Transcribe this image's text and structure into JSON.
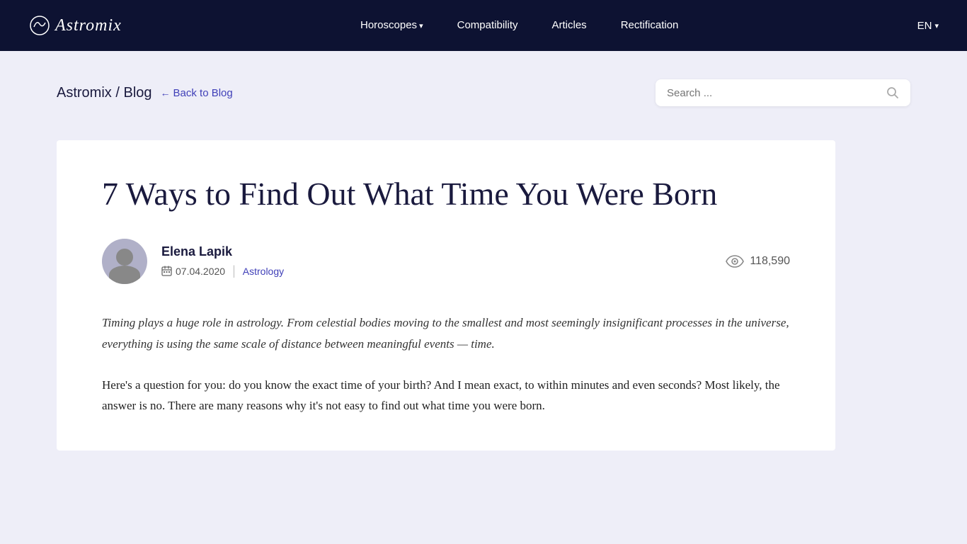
{
  "nav": {
    "logo_text": "Astromix",
    "links": [
      {
        "label": "Horoscopes",
        "has_arrow": true
      },
      {
        "label": "Compatibility",
        "has_arrow": false
      },
      {
        "label": "Articles",
        "has_arrow": false
      },
      {
        "label": "Rectification",
        "has_arrow": false
      }
    ],
    "lang": "EN"
  },
  "breadcrumb": {
    "site": "Astromix",
    "separator": "/",
    "section": "Blog",
    "back_label": "Back to Blog"
  },
  "search": {
    "placeholder": "Search ..."
  },
  "article": {
    "title": "7 Ways to Find Out What Time You Were Born",
    "author": {
      "name": "Elena Lapik",
      "date": "07.04.2020",
      "category": "Astrology"
    },
    "views": "118,590",
    "intro": "Timing plays a huge role in astrology. From celestial bodies moving to the smallest and most seemingly insignificant processes in the universe, everything is using the same scale of distance between meaningful events — time.",
    "body": "Here's a question for you: do you know the exact time of your birth? And I mean exact, to within minutes and even seconds? Most likely, the answer is no. There are many reasons why it's not easy to find out what time you were born."
  }
}
